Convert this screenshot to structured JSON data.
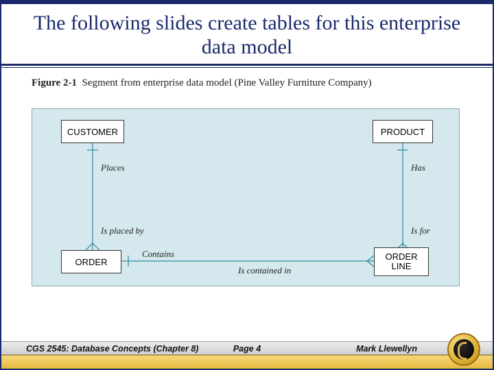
{
  "title": "The following slides create tables for this enterprise data model",
  "figure": {
    "label": "Figure 2-1",
    "caption": "Segment from enterprise data model (Pine Valley Furniture Company)"
  },
  "entities": {
    "customer": "CUSTOMER",
    "product": "PRODUCT",
    "order": "ORDER",
    "order_line": "ORDER\nLINE"
  },
  "relations": {
    "places": "Places",
    "is_placed_by": "Is placed by",
    "has": "Has",
    "is_for": "Is for",
    "contains": "Contains",
    "is_contained_in": "Is contained in"
  },
  "footer": {
    "left": "CGS 2545: Database Concepts  (Chapter 8)",
    "center": "Page 4",
    "right": "Mark Llewellyn"
  }
}
